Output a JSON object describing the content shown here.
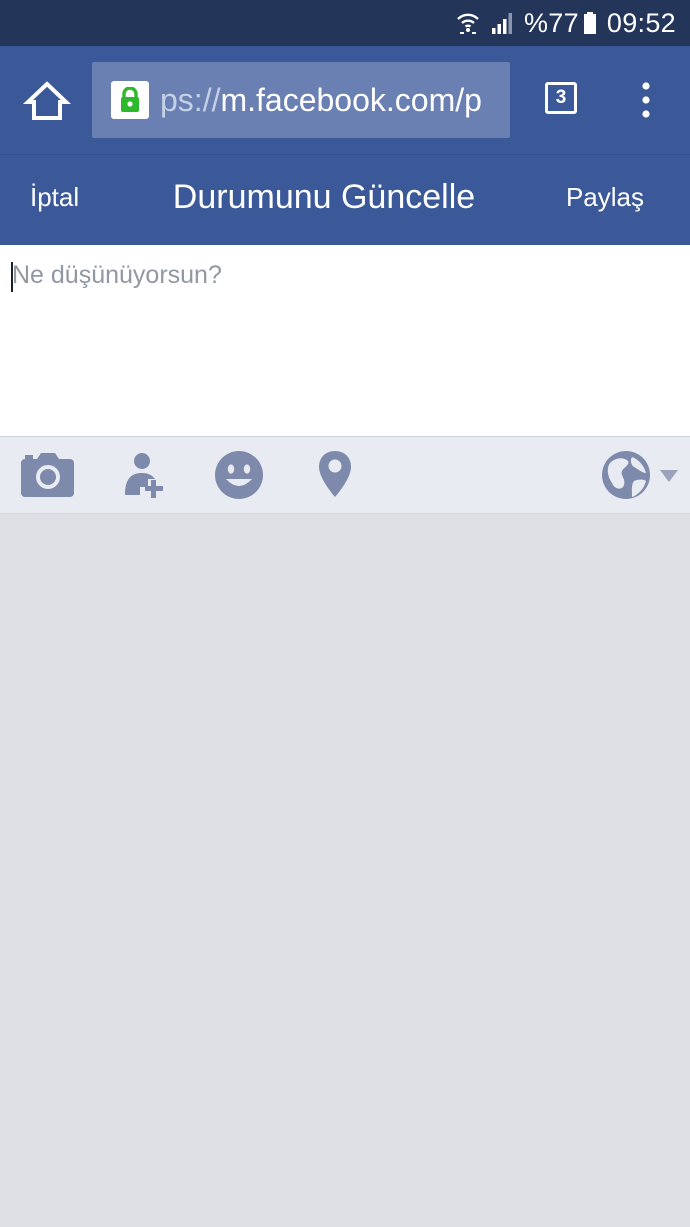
{
  "status_bar": {
    "battery": "%77",
    "time": "09:52",
    "icons": [
      "wifi-icon",
      "signal-icon",
      "battery-icon"
    ]
  },
  "browser": {
    "url_faint": "ps://",
    "url_main": "m.facebook.com/p",
    "tab_count": "3",
    "icons": [
      "home-icon",
      "lock-icon",
      "overflow-menu-icon"
    ]
  },
  "header": {
    "cancel_label": "İptal",
    "title": "Durumunu Güncelle",
    "share_label": "Paylaş"
  },
  "compose": {
    "placeholder": "Ne düşünüyorsun?",
    "value": ""
  },
  "toolbar": {
    "icons": [
      "camera-icon",
      "tag-friends-icon",
      "feeling-icon",
      "location-icon",
      "globe-icon",
      "audience-dropdown-icon"
    ]
  },
  "colors": {
    "brand": "#3b5998",
    "status_bar": "#233559",
    "url_field": "#6a80b3",
    "lock_green": "#2eb82e",
    "toolbar_bg": "#e9ebf2",
    "toolbar_icon": "#7d8aab",
    "content_bg": "#dfe0e4"
  }
}
